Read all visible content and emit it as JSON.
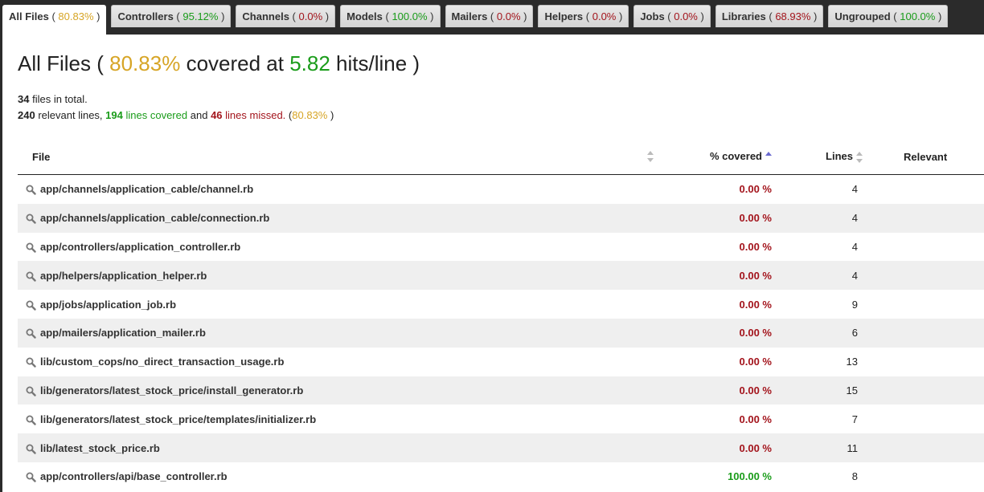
{
  "tabs": [
    {
      "name": "All Files",
      "pct": "80.83%",
      "color": "yellow",
      "active": true
    },
    {
      "name": "Controllers",
      "pct": "95.12%",
      "color": "green"
    },
    {
      "name": "Channels",
      "pct": "0.0%",
      "color": "red"
    },
    {
      "name": "Models",
      "pct": "100.0%",
      "color": "green"
    },
    {
      "name": "Mailers",
      "pct": "0.0%",
      "color": "red"
    },
    {
      "name": "Helpers",
      "pct": "0.0%",
      "color": "red"
    },
    {
      "name": "Jobs",
      "pct": "0.0%",
      "color": "red"
    },
    {
      "name": "Libraries",
      "pct": "68.93%",
      "color": "red"
    },
    {
      "name": "Ungrouped",
      "pct": "100.0%",
      "color": "green"
    }
  ],
  "header": {
    "title_prefix": "All Files (",
    "covered_pct": "80.83%",
    "covered_at": "covered at",
    "hits": "5.82",
    "hits_suffix": "hits/line )"
  },
  "summary": {
    "files_count": "34",
    "files_text": "files in total.",
    "relevant_count": "240",
    "relevant_text": "relevant lines,",
    "covered_count": "194",
    "covered_text": "lines covered",
    "and_text": "and",
    "missed_count": "46",
    "missed_text": "lines missed.",
    "pct_open": "(",
    "pct": "80.83%",
    "pct_close": ")"
  },
  "table": {
    "columns": {
      "file": "File",
      "covered": "% covered",
      "lines": "Lines",
      "relevant": "Relevant"
    },
    "rows": [
      {
        "file": "app/channels/application_cable/channel.rb",
        "covered": "0.00 %",
        "lines": "4",
        "status": "red"
      },
      {
        "file": "app/channels/application_cable/connection.rb",
        "covered": "0.00 %",
        "lines": "4",
        "status": "red"
      },
      {
        "file": "app/controllers/application_controller.rb",
        "covered": "0.00 %",
        "lines": "4",
        "status": "red"
      },
      {
        "file": "app/helpers/application_helper.rb",
        "covered": "0.00 %",
        "lines": "4",
        "status": "red"
      },
      {
        "file": "app/jobs/application_job.rb",
        "covered": "0.00 %",
        "lines": "9",
        "status": "red"
      },
      {
        "file": "app/mailers/application_mailer.rb",
        "covered": "0.00 %",
        "lines": "6",
        "status": "red"
      },
      {
        "file": "lib/custom_cops/no_direct_transaction_usage.rb",
        "covered": "0.00 %",
        "lines": "13",
        "status": "red"
      },
      {
        "file": "lib/generators/latest_stock_price/install_generator.rb",
        "covered": "0.00 %",
        "lines": "15",
        "status": "red"
      },
      {
        "file": "lib/generators/latest_stock_price/templates/initializer.rb",
        "covered": "0.00 %",
        "lines": "7",
        "status": "red"
      },
      {
        "file": "lib/latest_stock_price.rb",
        "covered": "0.00 %",
        "lines": "11",
        "status": "red"
      },
      {
        "file": "app/controllers/api/base_controller.rb",
        "covered": "100.00 %",
        "lines": "8",
        "status": "green"
      }
    ]
  },
  "colors": {
    "green": "#1a9c1a",
    "red": "#a3141c",
    "yellow": "#d7a526"
  },
  "icons": {
    "file_row": "magnifier-icon",
    "sort": "sort-arrows-icon"
  }
}
